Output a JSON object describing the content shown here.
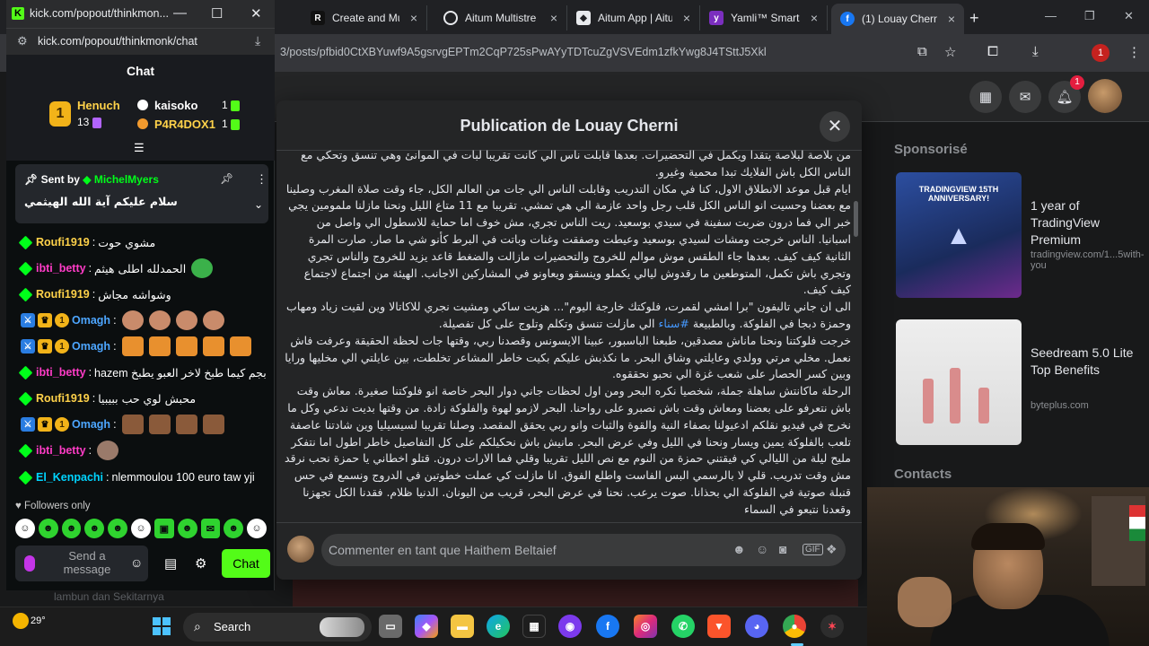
{
  "browser": {
    "tabs": [
      {
        "label": "Create and Mult",
        "icon": "R"
      },
      {
        "label": "Aitum Multistre",
        "icon": "gh"
      },
      {
        "label": "Aitum App | Aitu",
        "icon": "aitum"
      },
      {
        "label": "Yamli™ Smart A",
        "icon": "yamli"
      },
      {
        "label": "(1) Louay Cherni",
        "icon": "f"
      }
    ],
    "url": "3/posts/pfbid0CtXBYuwf9A5gsrvgEPTm2CqP725sPwAYyTDTcuZgVSVEdm1zfkYwg8J4TSttJ5Xkl",
    "profile_badge": "1"
  },
  "facebook": {
    "notification_count": "1",
    "sponsored_label": "Sponsorisé",
    "ads": [
      {
        "image_text": "TRADINGVIEW 15TH ANNIVERSARY!",
        "title": "1 year of TradingView Premium",
        "url": "tradingview.com/1...5with-you"
      },
      {
        "title": "Seedream 5.0 Lite Top Benefits",
        "url": "byteplus.com"
      }
    ],
    "contacts_label": "Contacts",
    "modal": {
      "title": "Publication de Louay Cherni",
      "paragraphs": [
        "من بلاصة لبلاصة يتقدا ويكمل في التحضيرات. بعدها قابلت ناس الي كانت تقريبا لبات في الموانئ وهي تنسق وتحكي مع الناس الكل باش الفلايك تبدا محمية وغيرو.",
        "ايام قبل موعد الانطلاق الاول، كنا في مكان التدريب وقابلت الناس الي جات من العالم الكل، جاء وقت صلاة المغرب وصلينا مع بعضنا وحسيت انو الناس الكل قلب رجل واحد عازمة الي هي تمشي. تقريبا مع 11 متاع الليل ونحنا مازلنا ملمومين يجي خبر الي فما درون ضربت سفينة في سيدي بوسعيد. ريت الناس تجري، مش خوف اما حماية للاسطول الي واصل من اسبانيا. الناس خرجت ومشات لسيدي بوسعيد وعيطت وصفقت وغنات وباتت في البرط كأنو شي ما صار. صارت المرة الثانية كيف كيف. بعدها جاء الطقس موش موالم للخروج والتحضيرات مازالت والضغط قاعد يزيد للخروج والناس تجري وتجري باش تكمل، المتوطعين ما رقدوش ليالي يكملو وينسقو ويعاونو في المشاركين الاجانب. الهيئة من اجتماع لاجتماع كيف كيف.",
        "الى ان جاني تاليفون \"برا امشي لقمرت، فلوكتك خارجة اليوم\"... هزيت ساكي ومشيت نجري للاكاتالا وين لقيت زياد ومهاب وحمزة دبجا في الفلوكة. وبالطبيعة",
        "خرجت فلوكتنا ونحنا ماناش مصدقين، طبعنا الباسبور، عبينا الايسونس وقصدنا ربي، وقتها جات لحظة الحقيقة وعرفت فاش نعمل. مخلي مرتي وولدي وعايلتي وشاق البحر. ما نكذبش عليكم بكيت خاطر المشاعر تخلطت، بين عايلتي الي مخليها ورايا وبين كسر الحصار على شعب غزة الي نحبو نحققوه.",
        "الرحلة ماكانتش ساهلة جملة، شخصيا نكره البحر ومن اول لحظات جاني دوار البحر خاصة انو فلوكتنا صغيرة. معاش وقت باش نتعرفو على بعضنا ومعاش وقت باش نصبرو على رواحنا. البحر لازمو لهوة والفلوكة زادة. من وقتها بديت ندعي وكل ما نخرج في فيديو نقلكم ادعيولنا بصفاء النية والقوة والثبات وانو ربي يحقق المقصد. وصلنا تقريبا لسيسيليا وين شادتنا عاصفة تلعب بالفلوكة يمين ويسار ونحنا في الليل وفي عرض البحر. مانيش باش نحكيلكم على كل التفاصيل خاطر اطول اما نتفكر مليح ليلة من الليالي كي فيقتني حمزة من النوم مع نص الليل تقريبا وقلي فما الارات درون. قتلو اخطاني يا حمزة نحب نرقد مش وقت تدريب. قلي لا بالرسمي البس الفاست واطلع الفوق. انا مازلت كي عملت خطوتين في الدروج ونسمع في حس قنبلة صوتية في الفلوكة الي بحذانا. صوت يرعب. نحنا في عرض البحر، قريب من اليونان. الدنيا ظلام. فقدنا الكل تجهزنا وقعدنا نتبعو في السماء"
      ],
      "hashtag": "#سناء",
      "hashtag_tail": "الي مازلت تنسق وتكلم وتلوج على كل تفصيلة.",
      "comment_placeholder": "Commenter en tant que Haithem Beltaief"
    }
  },
  "kick": {
    "window_title": "kick.com/popout/thinkmon...",
    "url": "kick.com/popout/thinkmonk/chat",
    "chat_title": "Chat",
    "leaderboard": [
      {
        "name": "Henuch",
        "count": "13",
        "color": "#ffd24a"
      },
      {
        "name": "kaisoko",
        "count": "1",
        "color": "#ffffff"
      },
      {
        "name": "P4R4DOX1",
        "count": "1",
        "color": "#ffd24a"
      }
    ],
    "leader_rank": "1",
    "pinned": {
      "sent_by_label": "Sent by",
      "user": "MichelMyers",
      "message": "سلام عليكم آية الله الهيثمي"
    },
    "messages": [
      {
        "user": "Roufi1919",
        "color": "#ffd24a",
        "text": "مشوي حوت",
        "rtl": true
      },
      {
        "user": "ibti_betty",
        "color": "#ff3cc7",
        "text": "الحمدلله اطلى هيثم",
        "rtl": true
      },
      {
        "user": "Roufi1919",
        "color": "#ffd24a",
        "text": "وشواشه مجاش",
        "rtl": true
      },
      {
        "user": "Omagh",
        "color": "#4da6ff",
        "text": ":",
        "rtl": false
      },
      {
        "user": "Omagh",
        "color": "#4da6ff",
        "text": ":",
        "rtl": false
      },
      {
        "user": "ibti_betty",
        "color": "#ff3cc7",
        "text": "hazem بجم كيما طبخ لاخر العبو يطبخ",
        "rtl": true
      },
      {
        "user": "Roufi1919",
        "color": "#ffd24a",
        "text": "محبش لوي حب ببيبيا",
        "rtl": true
      },
      {
        "user": "Omagh",
        "color": "#4da6ff",
        "text": ":",
        "rtl": false
      },
      {
        "user": "ibti_betty",
        "color": "#ff3cc7",
        "text": ":",
        "rtl": false
      },
      {
        "user": "El_Kenpachi",
        "color": "#00d4ff",
        "text": "nlemmoulou 100 euro taw yji",
        "rtl": false
      }
    ],
    "followers_only": "Followers only",
    "send_placeholder": "Send a message",
    "chat_button": "Chat",
    "below_text": "lambun dan Sekitarnya"
  },
  "taskbar": {
    "weather": "29°",
    "search_label": "Search"
  },
  "colors": {
    "kick_green": "#53fc18",
    "fb_blue": "#4599ff",
    "fb_surface": "#242526"
  }
}
